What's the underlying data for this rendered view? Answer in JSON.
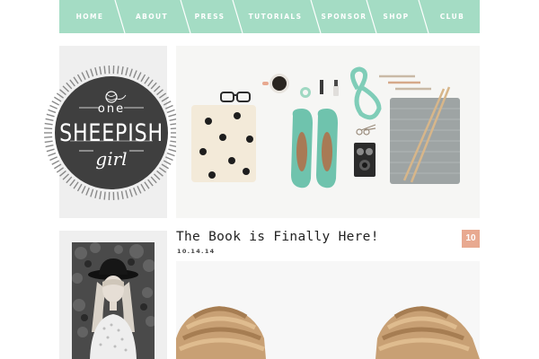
{
  "nav": {
    "items": [
      "HOME",
      "ABOUT",
      "PRESS",
      "TUTORIALS",
      "SPONSOR",
      "SHOP",
      "CLUB"
    ],
    "background": "#a4dcc4"
  },
  "logo": {
    "line1": "one",
    "line2": "SHEEPISH",
    "line3": "girl"
  },
  "post": {
    "title": "The Book is Finally Here!",
    "date": "10.14.14",
    "comment_count": "10",
    "badge_color": "#e8a990"
  },
  "colors": {
    "mint": "#a4dcc4",
    "logo_dark": "#3f3f3f",
    "panel": "#efefef"
  }
}
